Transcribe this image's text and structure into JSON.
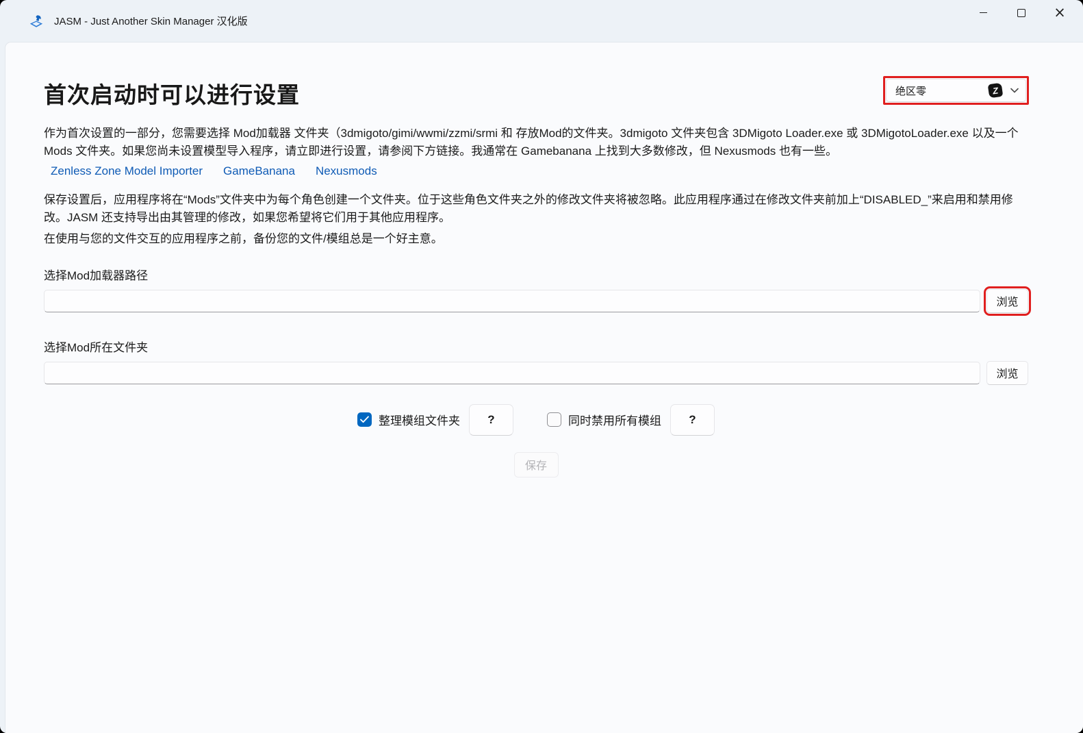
{
  "window": {
    "title": "JASM - Just Another Skin Manager 汉化版"
  },
  "header": {
    "page_title": "首次启动时可以进行设置",
    "game_selector": {
      "value": "绝区零",
      "badge_letter": "Z",
      "highlighted": true
    }
  },
  "intro": {
    "paragraph1": "作为首次设置的一部分，您需要选择 Mod加载器 文件夹（3dmigoto/gimi/wwmi/zzmi/srmi 和 存放Mod的文件夹。3dmigoto 文件夹包含 3DMigoto Loader.exe 或 3DMigotoLoader.exe 以及一个 Mods 文件夹。如果您尚未设置模型导入程序，请立即进行设置，请参阅下方链接。我通常在 Gamebanana 上找到大多数修改，但 Nexusmods 也有一些。",
    "links": [
      "Zenless Zone Model Importer",
      "GameBanana",
      "Nexusmods"
    ],
    "paragraph2": "保存设置后，应用程序将在“Mods”文件夹中为每个角色创建一个文件夹。位于这些角色文件夹之外的修改文件夹将被忽略。此应用程序通过在修改文件夹前加上“DISABLED_”来启用和禁用修改。JASM 还支持导出由其管理的修改，如果您希望将它们用于其他应用程序。",
    "paragraph3": "在使用与您的文件交互的应用程序之前，备份您的文件/模组总是一个好主意。"
  },
  "form": {
    "loader_path": {
      "label": "选择Mod加载器路径",
      "value": "",
      "browse_label": "浏览",
      "highlighted": true
    },
    "mods_folder": {
      "label": "选择Mod所在文件夹",
      "value": "",
      "browse_label": "浏览"
    },
    "checkboxes": [
      {
        "label": "整理模组文件夹",
        "checked": true,
        "help_label": "?"
      },
      {
        "label": "同时禁用所有模组",
        "checked": false,
        "help_label": "?"
      }
    ],
    "save_label": "保存"
  },
  "icons": {
    "app_logo": "jasm-logo-icon",
    "minimize": "minimize-icon",
    "maximize": "maximize-icon",
    "close": "close-icon",
    "game_badge": "zzz-badge-icon",
    "dropdown_chevron": "chevron-down-icon",
    "checkbox_check": "check-icon"
  },
  "colors": {
    "annotation_red": "#e01f1f",
    "accent_blue": "#0067c0",
    "link_blue": "#0f5bb5",
    "titlebar_bg": "#edf2f7",
    "content_bg": "#fafbfd"
  }
}
